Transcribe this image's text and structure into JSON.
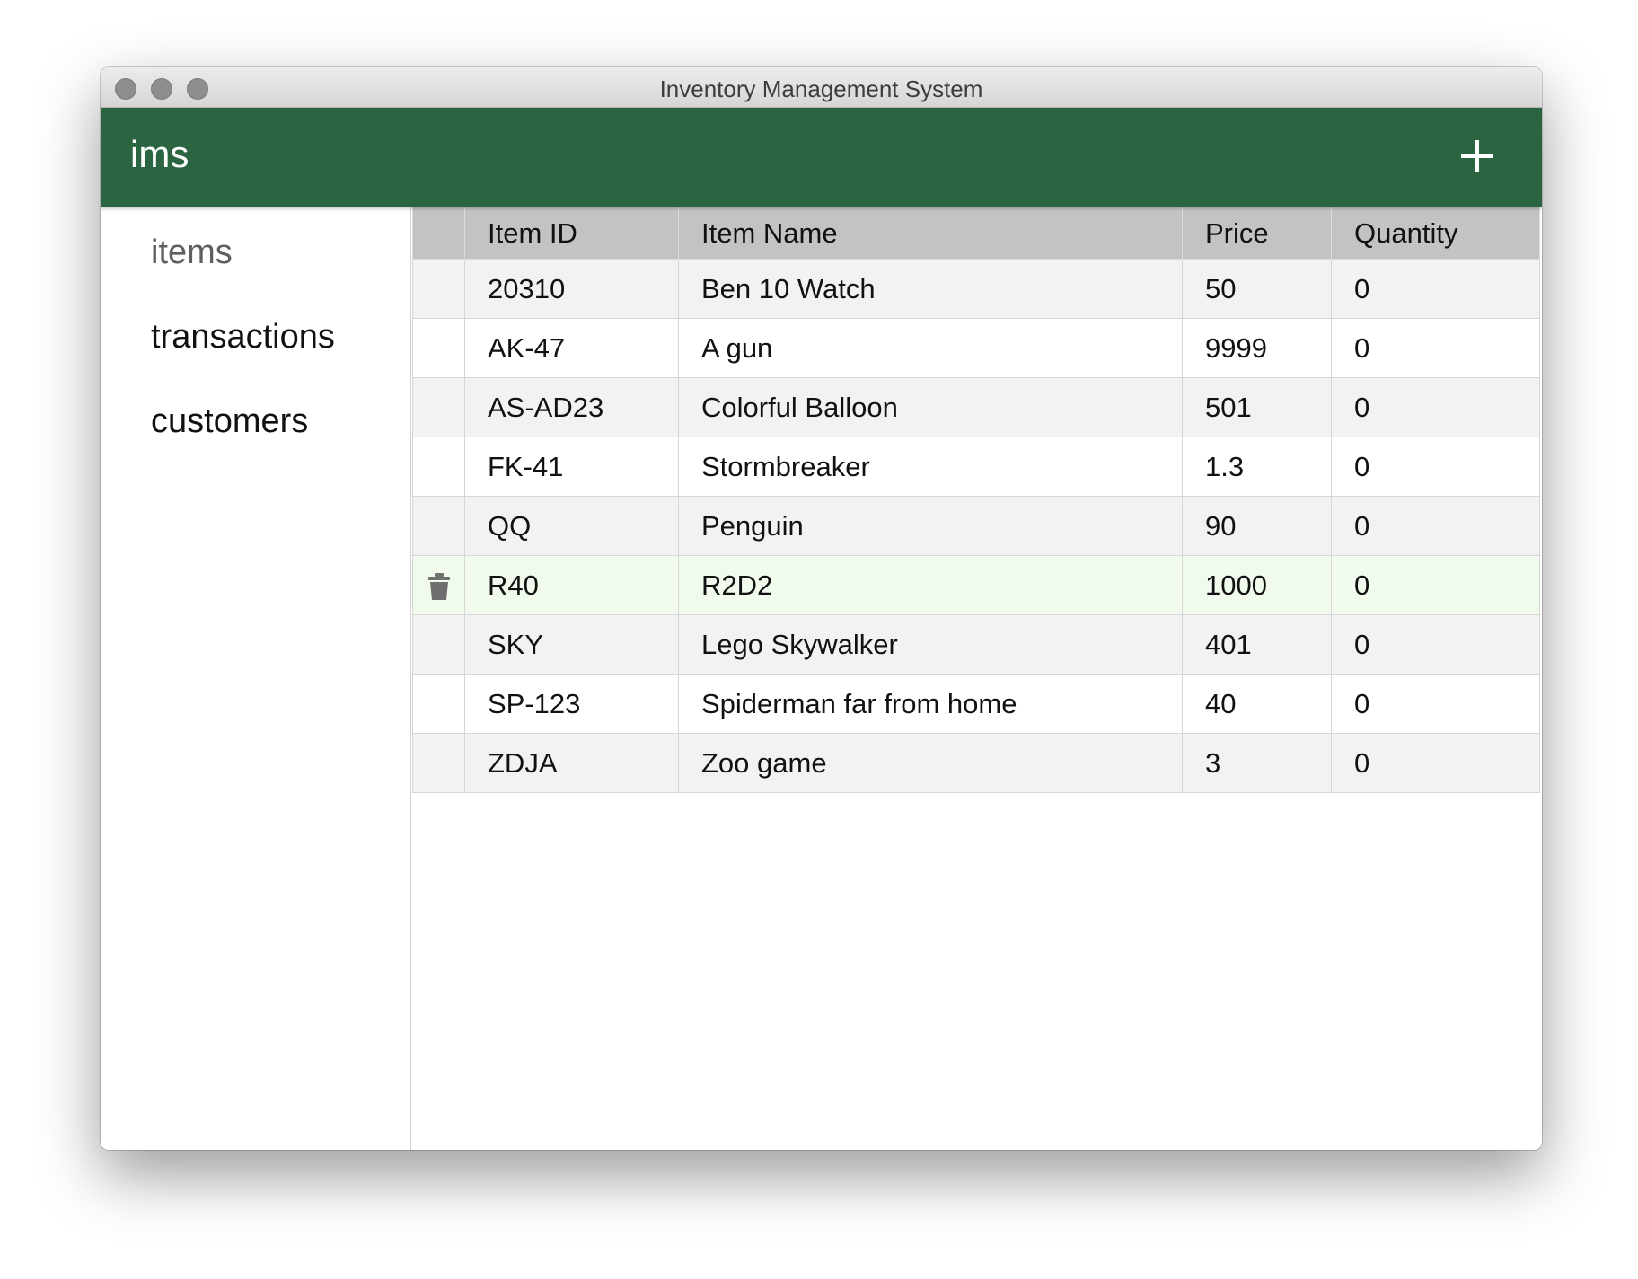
{
  "window": {
    "title": "Inventory Management System"
  },
  "appbar": {
    "brand": "ims"
  },
  "sidebar": {
    "items": [
      {
        "label": "items",
        "active": true
      },
      {
        "label": "transactions",
        "active": false
      },
      {
        "label": "customers",
        "active": false
      }
    ]
  },
  "table": {
    "columns": [
      "",
      "Item ID",
      "Item Name",
      "Price",
      "Quantity"
    ],
    "rows": [
      {
        "id": "20310",
        "name": "Ben 10 Watch",
        "price": "50",
        "quantity": "0"
      },
      {
        "id": "AK-47",
        "name": "A gun",
        "price": "9999",
        "quantity": "0"
      },
      {
        "id": "AS-AD23",
        "name": "Colorful Balloon",
        "price": "501",
        "quantity": "0"
      },
      {
        "id": "FK-41",
        "name": "Stormbreaker",
        "price": "1.3",
        "quantity": "0"
      },
      {
        "id": "QQ",
        "name": "Penguin",
        "price": "90",
        "quantity": "0"
      },
      {
        "id": "R40",
        "name": "R2D2",
        "price": "1000",
        "quantity": "0",
        "selected": true
      },
      {
        "id": "SKY",
        "name": "Lego Skywalker",
        "price": "401",
        "quantity": "0"
      },
      {
        "id": "SP-123",
        "name": "Spiderman far from home",
        "price": "40",
        "quantity": "0"
      },
      {
        "id": "ZDJA",
        "name": "Zoo game",
        "price": "3",
        "quantity": "0"
      }
    ]
  },
  "colors": {
    "appbar": "#2b6440",
    "header_row": "#c3c3c3",
    "selected_row": "#f1fbed"
  },
  "icons": {
    "add": "plus-icon",
    "delete": "trash-icon"
  }
}
